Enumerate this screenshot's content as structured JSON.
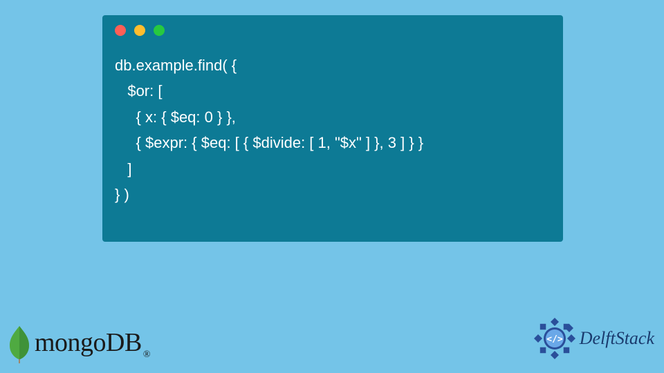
{
  "code": {
    "lines": [
      "db.example.find( {",
      "   $or: [",
      "     { x: { $eq: 0 } },",
      "     { $expr: { $eq: [ { $divide: [ 1, \"$x\" ] }, 3 ] } }",
      "   ]",
      "} )"
    ]
  },
  "logos": {
    "mongo": {
      "text": "mongoDB",
      "reg": "®",
      "leaf_color": "#4faa41"
    },
    "delft": {
      "text": "DelftStack",
      "badge_color": "#2a4f9a",
      "code_glyph": "</>"
    }
  },
  "window": {
    "dots": [
      "red",
      "yellow",
      "green"
    ]
  }
}
